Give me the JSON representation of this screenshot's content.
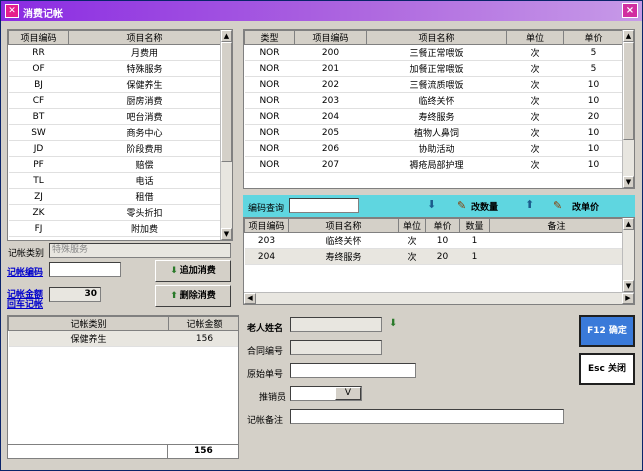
{
  "window": {
    "title": "消费记帐",
    "close": "×"
  },
  "catalog": {
    "headers": [
      "项目编码",
      "项目名称"
    ],
    "rows": [
      [
        "RR",
        "月费用"
      ],
      [
        "OF",
        "特殊服务"
      ],
      [
        "BJ",
        "保健养生"
      ],
      [
        "CF",
        "厨房消费"
      ],
      [
        "BT",
        "吧台消费"
      ],
      [
        "SW",
        "商务中心"
      ],
      [
        "JD",
        "阶段费用"
      ],
      [
        "PF",
        "赔偿"
      ],
      [
        "TL",
        "电话"
      ],
      [
        "ZJ",
        "租借"
      ],
      [
        "ZK",
        "零头折扣"
      ],
      [
        "FJ",
        "附加费"
      ]
    ]
  },
  "items": {
    "headers": [
      "类型",
      "项目编码",
      "项目名称",
      "单位",
      "单价"
    ],
    "rows": [
      [
        "NOR",
        "200",
        "三餐正常喂饭",
        "次",
        "5"
      ],
      [
        "NOR",
        "201",
        "加餐正常喂饭",
        "次",
        "5"
      ],
      [
        "NOR",
        "202",
        "三餐流质喂饭",
        "次",
        "10"
      ],
      [
        "NOR",
        "203",
        "临终关怀",
        "次",
        "10"
      ],
      [
        "NOR",
        "204",
        "寿终服务",
        "次",
        "20"
      ],
      [
        "NOR",
        "205",
        "植物人鼻饲",
        "次",
        "10"
      ],
      [
        "NOR",
        "206",
        "协助活动",
        "次",
        "10"
      ],
      [
        "NOR",
        "207",
        "褥疮局部护理",
        "次",
        "10"
      ]
    ]
  },
  "query_bar": {
    "label": "编码查询",
    "value": "",
    "change_qty": "改数量",
    "change_price": "改单价"
  },
  "selected": {
    "headers": [
      "项目编码",
      "项目名称",
      "单位",
      "单价",
      "数量",
      "备注"
    ],
    "rows": [
      [
        "203",
        "临终关怀",
        "次",
        "10",
        "1",
        ""
      ],
      [
        "204",
        "寿终服务",
        "次",
        "20",
        "1",
        ""
      ]
    ]
  },
  "left_form": {
    "category_label": "记帐类别",
    "category_value": "特殊服务",
    "code_label": "记帐编码",
    "code_value": "",
    "amount_label": "记帐金额",
    "amount_value": "30",
    "enter_label": "回车记帐",
    "add_button": "追加消费",
    "delete_button": "删除消费"
  },
  "summary": {
    "headers": [
      "记帐类别",
      "记帐金额"
    ],
    "rows": [
      [
        "保健养生",
        "156"
      ]
    ],
    "total": "156"
  },
  "bottom_form": {
    "elder_label": "老人姓名",
    "contract_label": "合同编号",
    "receipt_label": "原始单号",
    "sales_label": "推销员",
    "sales_select": "V",
    "note_label": "记帐备注"
  },
  "actions": {
    "confirm": "F12 确定",
    "close": "Esc 关闭"
  },
  "colors": {
    "title_start": "#8a2be2",
    "cyan_bar": "#5fd6e0",
    "link": "#0000cc",
    "confirm_bg": "#3a7ad9"
  }
}
